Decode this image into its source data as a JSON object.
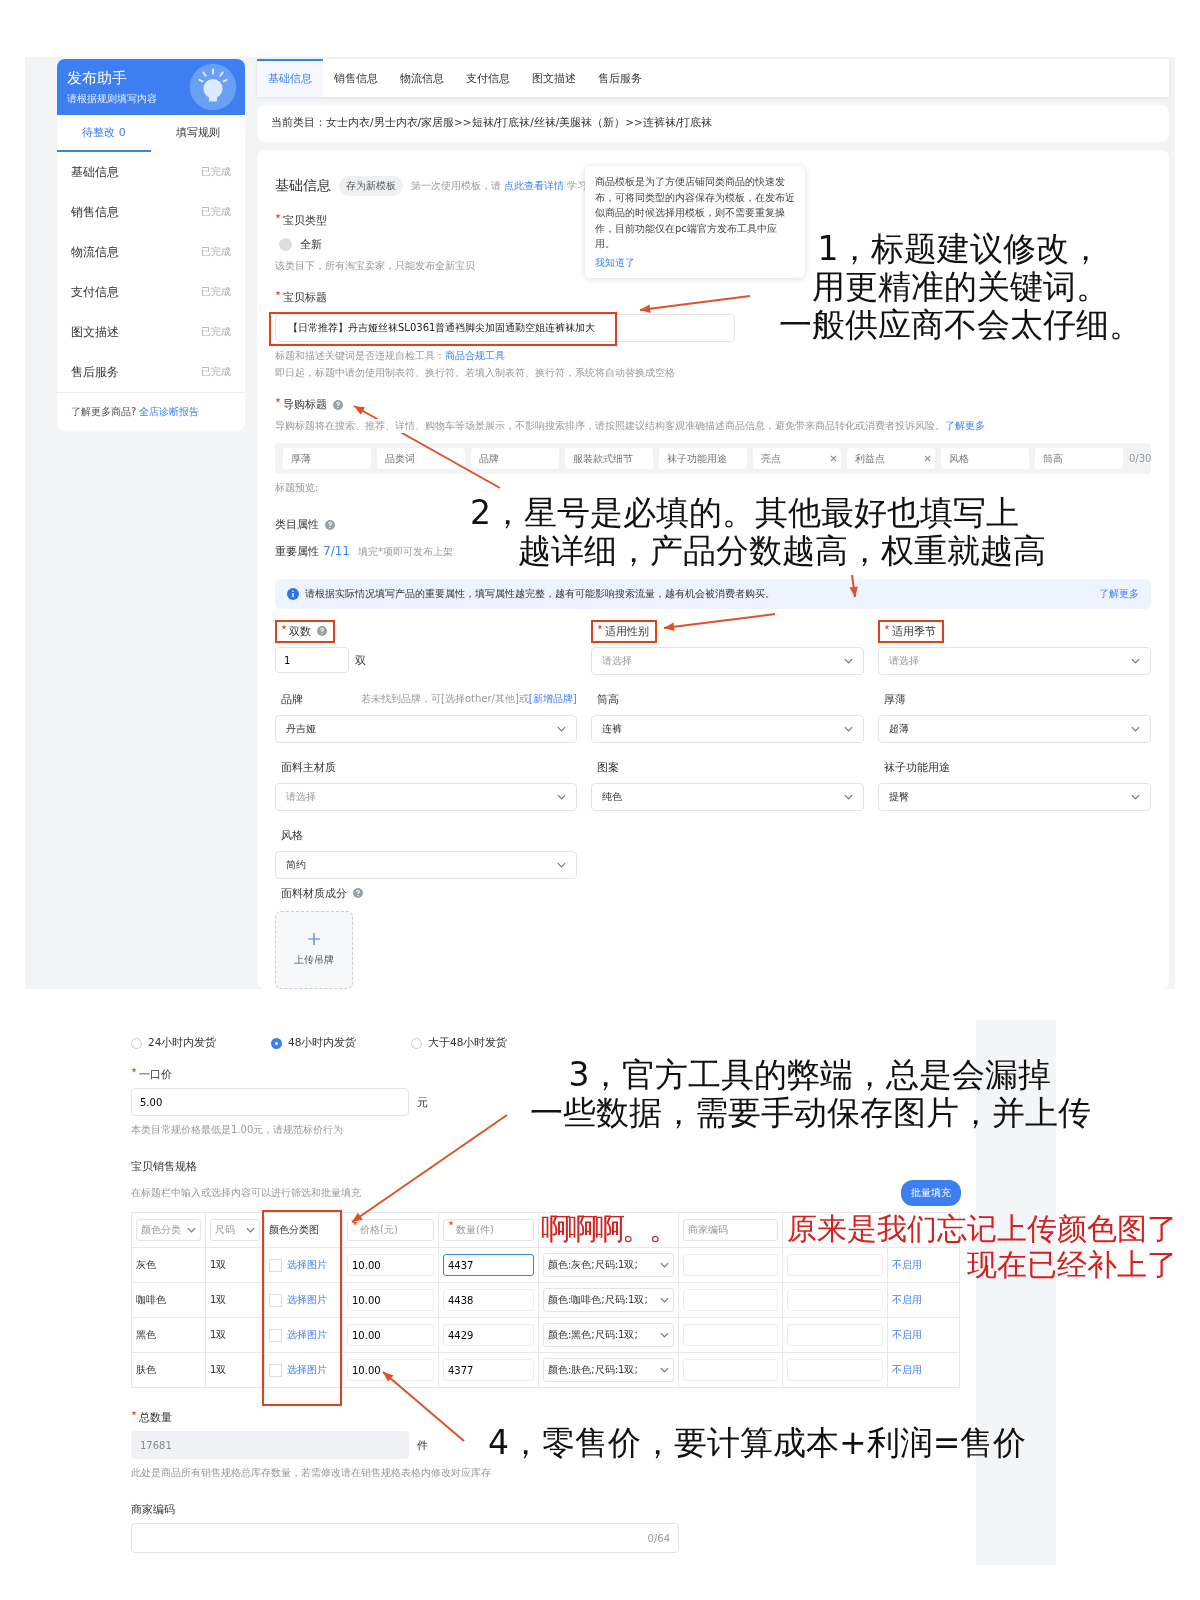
{
  "top_screen": {
    "sidebar": {
      "title": "发布助手",
      "subtitle": "请根据规则填写内容",
      "tabs": [
        {
          "label": "待整改 0",
          "selected": true
        },
        {
          "label": "填写规则",
          "selected": false
        }
      ],
      "items": [
        {
          "label": "基础信息",
          "status": "已完成"
        },
        {
          "label": "销售信息",
          "status": "已完成"
        },
        {
          "label": "物流信息",
          "status": "已完成"
        },
        {
          "label": "支付信息",
          "status": "已完成"
        },
        {
          "label": "图文描述",
          "status": "已完成"
        },
        {
          "label": "售后服务",
          "status": "已完成"
        }
      ],
      "footer_text": "了解更多商品?",
      "footer_link": "全店诊断报告"
    },
    "tabs": [
      {
        "label": "基础信息",
        "selected": true
      },
      {
        "label": "销售信息",
        "selected": false
      },
      {
        "label": "物流信息",
        "selected": false
      },
      {
        "label": "支付信息",
        "selected": false
      },
      {
        "label": "图文描述",
        "selected": false
      },
      {
        "label": "售后服务",
        "selected": false
      }
    ],
    "breadcrumb": "当前类目：女士内衣/男士内衣/家居服>>短袜/打底袜/丝袜/美腿袜（新）>>连裤袜/打底袜",
    "form": {
      "section_title": "基础信息",
      "template_button": "存为新模板",
      "template_hint_before": "第一次使用模板，请",
      "template_hint_link": "点此查看详情",
      "template_hint_after": "学习",
      "tooltip": {
        "text": "商品模板是为了方便店铺同类商品的快速发布，可将同类型的内容保存为模板，在发布近似商品的时候选择用模板，则不需要重复操作，目前功能仅在pc端官方发布工具中应用。",
        "link": "我知道了"
      },
      "item_type": {
        "label": "宝贝类型",
        "required": true,
        "option": {
          "label": "全新",
          "disabled": true
        },
        "help": "该类目下，所有淘宝卖家，只能发布全新宝贝"
      },
      "item_title": {
        "label": "宝贝标题",
        "required": true,
        "value": "【日常推荐】丹吉娅丝袜SL0361普通裆脚尖加固通勤空姐连裤袜加大",
        "highlighted": true,
        "help_text": "标题和描述关键词是否违规自检工具：",
        "help_link": "商品合规工具",
        "help_2": "即日起，标题中请勿使用制表符、换行符。若填入制表符、换行符，系统将自动替换成空格"
      },
      "guide_title": {
        "label": "导购标题",
        "required": true,
        "help_text": "导购标题将在搜索、推荐、详情、购物车等场景展示，不影响搜索排序，请按照建议结构客观准确描述商品信息，避免带来商品转化或消费者投诉风险。",
        "help_link": "了解更多",
        "chips": [
          {
            "placeholder": "厚薄",
            "clearable": false
          },
          {
            "placeholder": "品类词",
            "clearable": false
          },
          {
            "placeholder": "品牌",
            "clearable": false
          },
          {
            "placeholder": "服装款式细节",
            "clearable": false
          },
          {
            "placeholder": "袜子功能用途",
            "clearable": false
          },
          {
            "placeholder": "亮点",
            "clearable": true
          },
          {
            "placeholder": "利益点",
            "clearable": true
          },
          {
            "placeholder": "风格",
            "clearable": false
          },
          {
            "placeholder": "筒高",
            "clearable": false
          }
        ],
        "counter": "0/30",
        "preview_label": "标题预览:"
      },
      "category_label": "类目属性",
      "important_label": "重要属性",
      "important_count": "7/11",
      "important_hint": "填完*项即可发布上架",
      "info_text": "请根据实际情况填写产品的重要属性，填写属性越完整，越有可能影响搜索流量，越有机会被消费者购买。",
      "info_link": "了解更多",
      "attributes": [
        {
          "label": "双数",
          "required": true,
          "help": true,
          "highlighted": true,
          "kind": "number",
          "value": "1",
          "unit": "双"
        },
        {
          "label": "适用性别",
          "required": true,
          "help": false,
          "highlighted": true,
          "kind": "select",
          "placeholder": "请选择"
        },
        {
          "label": "适用季节",
          "required": true,
          "help": false,
          "highlighted": true,
          "kind": "select",
          "placeholder": "请选择"
        },
        {
          "label": "品牌",
          "required": false,
          "help": false,
          "highlighted": false,
          "kind": "select",
          "value": "丹吉娅",
          "hint": "若未找到品牌，可[选择other/其他]或",
          "hint_link": "[新增品牌]"
        },
        {
          "label": "筒高",
          "required": false,
          "help": false,
          "highlighted": false,
          "kind": "select",
          "value": "连裤"
        },
        {
          "label": "厚薄",
          "required": false,
          "help": false,
          "highlighted": false,
          "kind": "select",
          "value": "超薄"
        },
        {
          "label": "面料主材质",
          "required": false,
          "help": false,
          "highlighted": false,
          "kind": "select",
          "placeholder": "请选择"
        },
        {
          "label": "图案",
          "required": false,
          "help": false,
          "highlighted": false,
          "kind": "select",
          "value": "纯色"
        },
        {
          "label": "袜子功能用途",
          "required": false,
          "help": false,
          "highlighted": false,
          "kind": "select",
          "value": "提臀"
        },
        {
          "label": "风格",
          "required": false,
          "help": false,
          "highlighted": false,
          "kind": "select",
          "value": "简约"
        },
        {
          "label": "面料材质成分",
          "required": false,
          "help": true,
          "highlighted": false,
          "kind": "upload",
          "upload_label": "上传吊牌"
        }
      ]
    }
  },
  "bottom_screen": {
    "delivery": [
      {
        "label": "24小时内发货",
        "selected": false
      },
      {
        "label": "48小时内发货",
        "selected": true
      },
      {
        "label": "大于48小时发货",
        "selected": false
      }
    ],
    "price": {
      "label": "一口价",
      "required": true,
      "value": "5.00",
      "unit": "元",
      "help": "本类目常规价格最低是1.00元，请规范标价行为"
    },
    "sku": {
      "title": "宝贝销售规格",
      "hint": "在标题栏中输入或选择内容可以进行筛选和批量填充",
      "button": "批量填充",
      "columns": [
        {
          "label": "颜色分类",
          "kind": "select",
          "required": false,
          "highlighted": false
        },
        {
          "label": "尺码",
          "kind": "select",
          "required": false,
          "highlighted": false
        },
        {
          "label": "颜色分类图",
          "kind": "text",
          "required": false,
          "highlighted": true
        },
        {
          "label": "价格(元)",
          "kind": "input",
          "required": true,
          "highlighted": false
        },
        {
          "label": "数量(件)",
          "kind": "input",
          "required": true,
          "highlighted": false
        },
        {
          "kind": "covered"
        },
        {
          "label": "商家编码",
          "kind": "input",
          "required": false,
          "highlighted": false
        },
        {
          "kind": "covered"
        },
        {
          "kind": "covered"
        }
      ],
      "rows": [
        {
          "color_name": "灰色",
          "size": "1双",
          "image_link": "选择图片",
          "price": "10.00",
          "quantity": "4437",
          "focused": true,
          "spec": "颜色:灰色;尺码:1双;",
          "action": "不启用"
        },
        {
          "color_name": "咖啡色",
          "size": "1双",
          "image_link": "选择图片",
          "price": "10.00",
          "quantity": "4438",
          "focused": false,
          "spec": "颜色:咖啡色;尺码:1双;",
          "action": "不启用"
        },
        {
          "color_name": "黑色",
          "size": "1双",
          "image_link": "选择图片",
          "price": "10.00",
          "quantity": "4429",
          "focused": false,
          "spec": "颜色:黑色;尺码:1双;",
          "action": "不启用"
        },
        {
          "color_name": "肤色",
          "size": "1双",
          "image_link": "选择图片",
          "price": "10.00",
          "quantity": "4377",
          "focused": false,
          "spec": "颜色:肤色;尺码:1双;",
          "action": "不启用"
        }
      ]
    },
    "total": {
      "label": "总数量",
      "required": true,
      "value": "17681",
      "unit": "件",
      "disabled": true,
      "help": "此处是商品所有销售规格总库存数量，若需修改请在销售规格表格内修改对应库存"
    },
    "merchant_code": {
      "label": "商家编码",
      "counter": "0/64"
    }
  },
  "annotations": [
    {
      "kind": "note",
      "lines": [
        "1，标题建议修改，",
        "用更精准的关键词。",
        "一般供应商不会太仔细。"
      ]
    },
    {
      "kind": "note",
      "lines": [
        "2，星号是必填的。其他最好也填写上",
        "越详细，产品分数越高，权重就越高"
      ]
    },
    {
      "kind": "note",
      "lines": [
        "3，官方工具的弊端，总是会漏掉",
        "一些数据，需要手动保存图片，并上传"
      ]
    },
    {
      "kind": "alert",
      "lines": [
        "啊啊啊。。",
        "原来是我们忘记上传颜色图了",
        "现在已经补上了"
      ]
    },
    {
      "kind": "note",
      "lines": [
        "4，零售价，要计算成本+利润=售价"
      ]
    }
  ]
}
